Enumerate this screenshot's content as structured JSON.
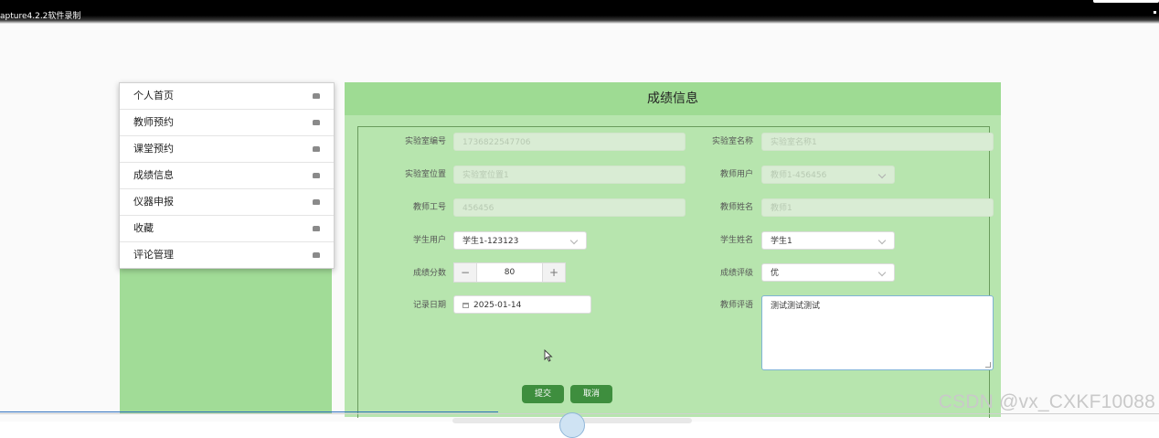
{
  "titlebar": {
    "text": "apture4.2.2软件录制"
  },
  "menu": {
    "items": [
      {
        "label": "个人首页"
      },
      {
        "label": "教师预约"
      },
      {
        "label": "课堂预约"
      },
      {
        "label": "成绩信息"
      },
      {
        "label": "仪器申报"
      },
      {
        "label": "收藏"
      },
      {
        "label": "评论管理"
      }
    ]
  },
  "panel": {
    "title": "成绩信息"
  },
  "form": {
    "lab_no": {
      "label": "实验室编号",
      "value": "1736822547706"
    },
    "lab_name": {
      "label": "实验室名称",
      "placeholder": "实验室名称1"
    },
    "lab_location": {
      "label": "实验室位置",
      "placeholder": "实验室位置1"
    },
    "teacher_user": {
      "label": "教师用户",
      "value": "教师1-456456"
    },
    "teacher_no": {
      "label": "教师工号",
      "value": "456456"
    },
    "teacher_name": {
      "label": "教师姓名",
      "value": "教师1"
    },
    "student_user": {
      "label": "学生用户",
      "value": "学生1-123123"
    },
    "student_name": {
      "label": "学生姓名",
      "value": "学生1"
    },
    "score": {
      "label": "成绩分数",
      "value": "80",
      "minus": "−",
      "plus": "+"
    },
    "grade": {
      "label": "成绩评级",
      "value": "优"
    },
    "record_date": {
      "label": "记录日期",
      "value": "2025-01-14"
    },
    "comment": {
      "label": "教师评语",
      "value": "测试测试测试"
    },
    "submit_label": "提交",
    "cancel_label": "取消"
  },
  "watermark": "CSDN @vx_CXKF10088",
  "colors": {
    "panel_bg": "#b7e5ae",
    "panel_header": "#9edb93",
    "left_bg": "#a1dc97",
    "button": "#3e8e3e"
  }
}
